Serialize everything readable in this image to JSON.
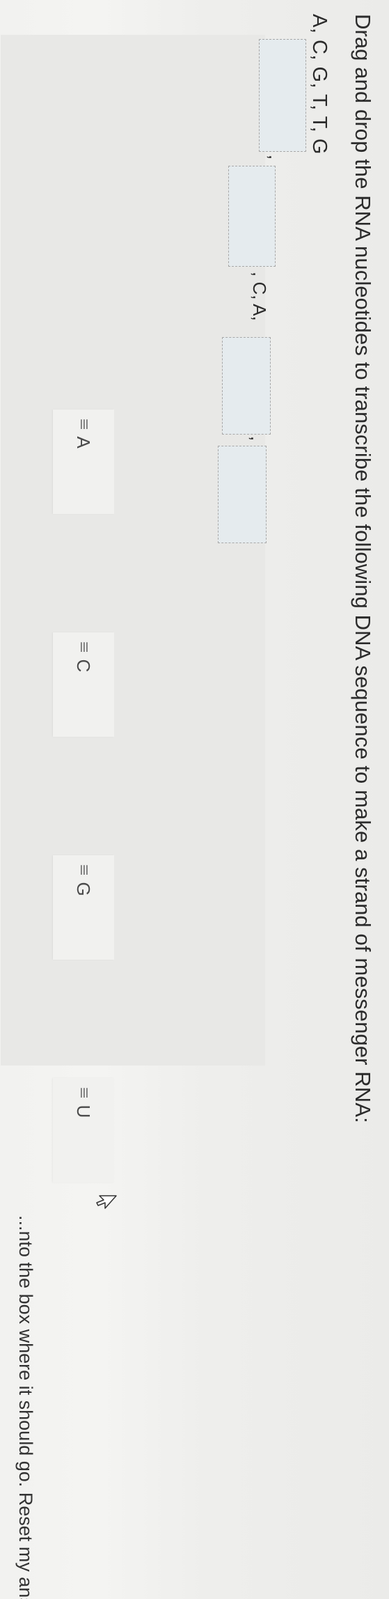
{
  "question": {
    "prompt": "Drag and drop the RNA nucleotides to transcribe the following DNA sequence to make a strand of messenger RNA:",
    "dna_sequence": "A, C, G, T, T, G"
  },
  "answer_row": {
    "sep_1": ",",
    "sep_2": ", C, A,",
    "sep_3": ","
  },
  "tiles": [
    {
      "label": "A"
    },
    {
      "label": "C"
    },
    {
      "label": "G"
    },
    {
      "label": "U"
    }
  ],
  "grip_glyph": "≡",
  "hint": {
    "partial_text": "...nto the box where it should go.",
    "reset_label": "Reset my answers."
  }
}
